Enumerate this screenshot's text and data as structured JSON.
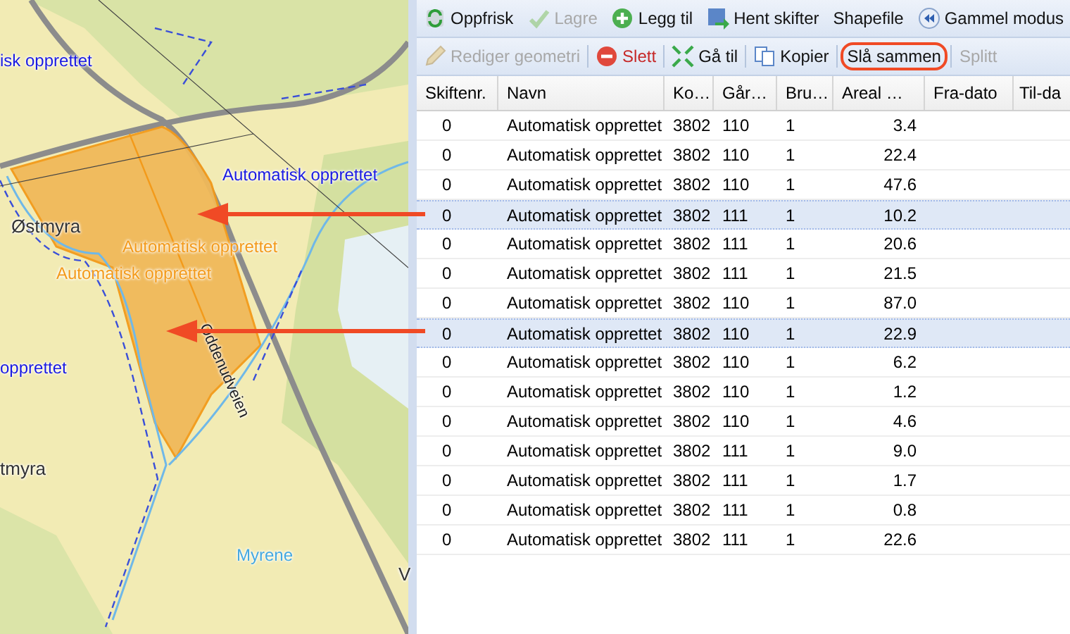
{
  "map": {
    "labels": [
      {
        "text": "isk opprettet",
        "kind": "parcel"
      },
      {
        "text": "Automatisk opprettet",
        "kind": "parcel"
      },
      {
        "text": "Østmyra",
        "kind": "place"
      },
      {
        "text": "Automatisk opprettet",
        "kind": "selected"
      },
      {
        "text": "Automatisk opprettet",
        "kind": "selected"
      },
      {
        "text": "opprettet",
        "kind": "parcel"
      },
      {
        "text": "Oddenudveien",
        "kind": "road"
      },
      {
        "text": "tmyra",
        "kind": "place"
      },
      {
        "text": "Myrene",
        "kind": "water"
      },
      {
        "text": "V",
        "kind": "place"
      }
    ]
  },
  "toolbar_rows": [
    [
      {
        "label": "Oppfrisk",
        "disabled": false,
        "danger": false,
        "annotated": false
      },
      {
        "label": "Lagre",
        "disabled": true,
        "danger": false,
        "annotated": false
      },
      {
        "label": "Legg til",
        "disabled": false,
        "danger": false,
        "annotated": false
      },
      {
        "label": "Hent skifter",
        "disabled": false,
        "danger": false,
        "annotated": false
      },
      {
        "label": "Shapefile",
        "disabled": false,
        "danger": false,
        "annotated": false
      },
      {
        "label": "Gammel modus",
        "disabled": false,
        "danger": false,
        "annotated": false
      }
    ],
    [
      {
        "label": "Rediger geometri",
        "disabled": true,
        "danger": false,
        "annotated": false
      },
      {
        "label": "Slett",
        "disabled": false,
        "danger": true,
        "annotated": false
      },
      {
        "label": "Gå til",
        "disabled": false,
        "danger": false,
        "annotated": false
      },
      {
        "label": "Kopier",
        "disabled": false,
        "danger": false,
        "annotated": false
      },
      {
        "label": "Slå sammen",
        "disabled": false,
        "danger": false,
        "annotated": true
      },
      {
        "label": "Splitt",
        "disabled": true,
        "danger": false,
        "annotated": false
      }
    ]
  ],
  "table": {
    "columns": [
      "Skiftenr.",
      "Navn",
      "Ko…",
      "Går…",
      "Bru…",
      "Areal …",
      "Fra-dato",
      "Til-da"
    ],
    "rows": [
      {
        "cells": [
          "0",
          "Automatisk opprettet",
          "3802",
          "110",
          "1",
          "3.4"
        ],
        "selected": false
      },
      {
        "cells": [
          "0",
          "Automatisk opprettet",
          "3802",
          "110",
          "1",
          "22.4"
        ],
        "selected": false
      },
      {
        "cells": [
          "0",
          "Automatisk opprettet",
          "3802",
          "110",
          "1",
          "47.6"
        ],
        "selected": false
      },
      {
        "cells": [
          "0",
          "Automatisk opprettet",
          "3802",
          "111",
          "1",
          "10.2"
        ],
        "selected": true
      },
      {
        "cells": [
          "0",
          "Automatisk opprettet",
          "3802",
          "111",
          "1",
          "20.6"
        ],
        "selected": false
      },
      {
        "cells": [
          "0",
          "Automatisk opprettet",
          "3802",
          "111",
          "1",
          "21.5"
        ],
        "selected": false
      },
      {
        "cells": [
          "0",
          "Automatisk opprettet",
          "3802",
          "110",
          "1",
          "87.0"
        ],
        "selected": false
      },
      {
        "cells": [
          "0",
          "Automatisk opprettet",
          "3802",
          "110",
          "1",
          "22.9"
        ],
        "selected": true
      },
      {
        "cells": [
          "0",
          "Automatisk opprettet",
          "3802",
          "110",
          "1",
          "6.2"
        ],
        "selected": false
      },
      {
        "cells": [
          "0",
          "Automatisk opprettet",
          "3802",
          "110",
          "1",
          "1.2"
        ],
        "selected": false
      },
      {
        "cells": [
          "0",
          "Automatisk opprettet",
          "3802",
          "110",
          "1",
          "4.6"
        ],
        "selected": false
      },
      {
        "cells": [
          "0",
          "Automatisk opprettet",
          "3802",
          "111",
          "1",
          "9.0"
        ],
        "selected": false
      },
      {
        "cells": [
          "0",
          "Automatisk opprettet",
          "3802",
          "111",
          "1",
          "1.7"
        ],
        "selected": false
      },
      {
        "cells": [
          "0",
          "Automatisk opprettet",
          "3802",
          "111",
          "1",
          "0.8"
        ],
        "selected": false
      },
      {
        "cells": [
          "0",
          "Automatisk opprettet",
          "3802",
          "111",
          "1",
          "22.6"
        ],
        "selected": false
      }
    ]
  }
}
